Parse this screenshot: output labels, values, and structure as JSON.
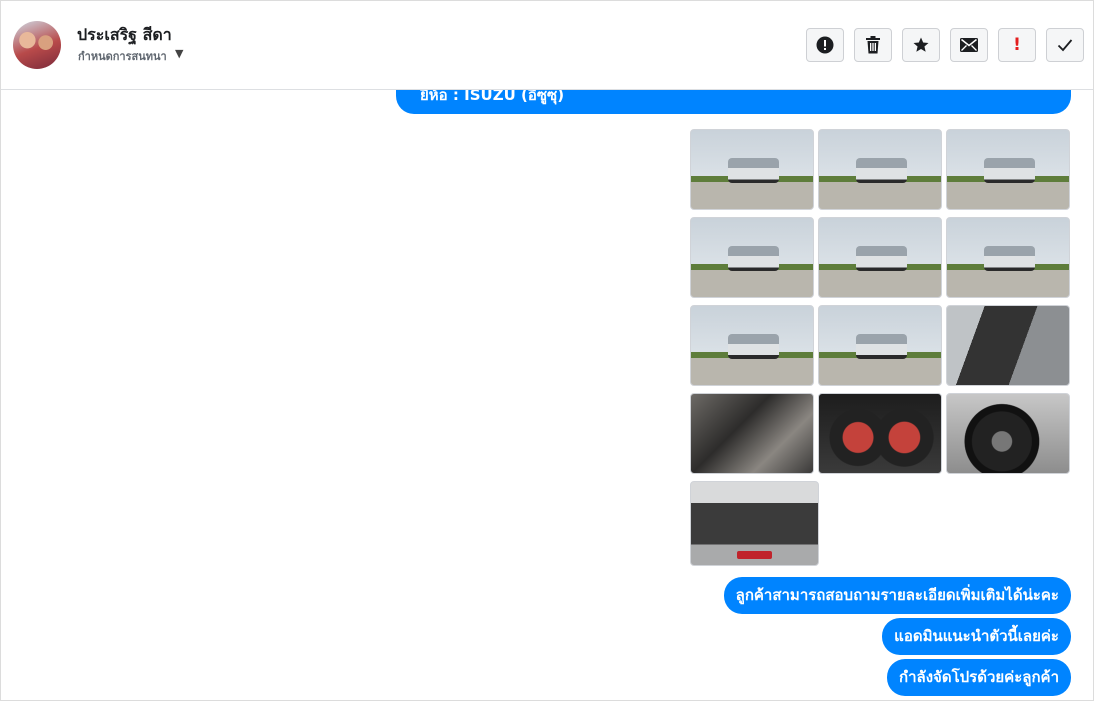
{
  "header": {
    "contact_name": "ประเสริฐ สีดา",
    "assign_label": "กำหนดการสนทนา",
    "actions": [
      {
        "name": "mark-spam-button",
        "icon": "exclamation-circle-icon"
      },
      {
        "name": "delete-button",
        "icon": "trash-icon"
      },
      {
        "name": "star-button",
        "icon": "star-icon"
      },
      {
        "name": "mark-unread-button",
        "icon": "envelope-icon"
      },
      {
        "name": "follow-up-button",
        "icon": "red-exclamation-icon"
      },
      {
        "name": "mark-done-button",
        "icon": "checkmark-icon"
      }
    ]
  },
  "conversation": {
    "top_message": "ยี่ห้อ : ISUZU (อีซูซุ)",
    "photos": [
      {
        "subject": "truck-front-left"
      },
      {
        "subject": "truck-front"
      },
      {
        "subject": "truck-front-right"
      },
      {
        "subject": "truck-left-side"
      },
      {
        "subject": "truck-right-side"
      },
      {
        "subject": "truck-rear-right"
      },
      {
        "subject": "truck-rear"
      },
      {
        "subject": "truck-rear-left"
      },
      {
        "subject": "door-interior"
      },
      {
        "subject": "seats-interior"
      },
      {
        "subject": "dashboard-gauges"
      },
      {
        "subject": "alloy-wheel"
      },
      {
        "subject": "engine-bay"
      }
    ],
    "messages": [
      "ลูกค้าสามารถสอบถามรายละเอียดเพิ่มเติมได้น่ะคะ",
      "แอดมินแนะนำตัวนี้เลยค่ะ",
      "กำลังจัดโปรด้วยค่ะลูกค้า"
    ]
  },
  "colors": {
    "bubble": "#0084ff",
    "bubble_text": "#ffffff",
    "follow_up_icon": "#e41e1e"
  }
}
